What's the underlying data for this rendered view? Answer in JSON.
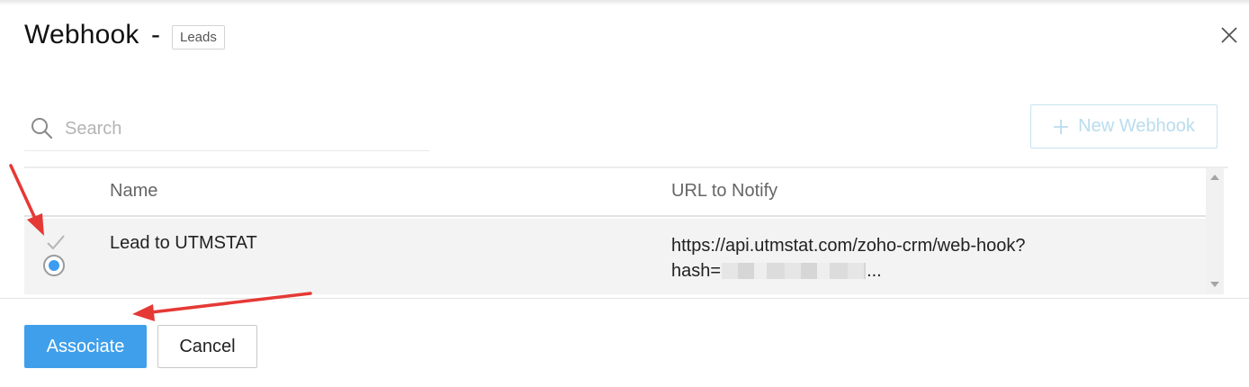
{
  "dialog": {
    "title": "Webhook",
    "separator": "-",
    "module_badge": "Leads"
  },
  "search": {
    "placeholder": "Search",
    "value": ""
  },
  "toolbar": {
    "new_webhook_label": "New Webhook"
  },
  "table": {
    "columns": [
      "Name",
      "URL to Notify"
    ],
    "rows": [
      {
        "name": "Lead to UTMSTAT",
        "url_line1": "https://api.utmstat.com/zoho-crm/web-hook?",
        "url_line2_prefix": "hash=",
        "url_line2_suffix": "...",
        "selected": true
      }
    ]
  },
  "footer": {
    "associate_label": "Associate",
    "cancel_label": "Cancel"
  },
  "colors": {
    "primary": "#3f9feb",
    "new_webhook_text": "#b9dcee",
    "annotation_arrow": "#e53935"
  },
  "icons": {
    "close": "close-icon",
    "search": "search-icon",
    "plus": "plus-icon",
    "check": "check-icon",
    "radio": "radio-selected"
  }
}
